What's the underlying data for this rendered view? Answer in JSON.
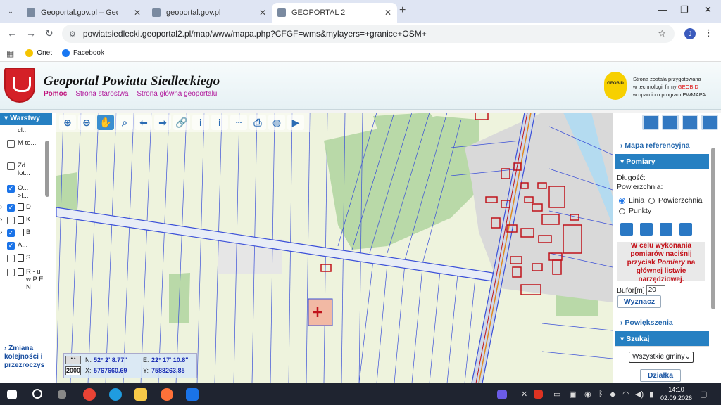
{
  "browser": {
    "tabs": [
      {
        "title": "Geoportal.gov.pl – Geoportal Infr",
        "active": false
      },
      {
        "title": "geoportal.gov.pl",
        "active": false
      },
      {
        "title": "GEOPORTAL 2",
        "active": true
      }
    ],
    "url": "powiatsiedlecki.geoportal2.pl/map/www/mapa.php?CFGF=wms&mylayers=+granice+OSM+",
    "profile_initial": "J",
    "bookmarks": [
      {
        "label": "Onet",
        "color": "#f5c400"
      },
      {
        "label": "Facebook",
        "color": "#1877f2"
      }
    ]
  },
  "site": {
    "title": "Geoportal Powiatu Siedleckiego",
    "nav": [
      "Pomoc",
      "Strona starostwa",
      "Strona główna geoportalu"
    ],
    "badge": "GEOBID",
    "credit_lines": [
      "Strona została przygotowana",
      "w technologii firmy ",
      "GEOBID",
      "w oparciu o program EWMAPA"
    ]
  },
  "layers_panel": {
    "header": "Warstwy",
    "items": [
      {
        "text": "cl...",
        "checked": null,
        "expander": false,
        "doc": false
      },
      {
        "text": "M to...",
        "checked": false,
        "expander": false,
        "doc": false
      },
      {
        "text": "Zd lot...",
        "checked": false,
        "expander": false,
        "doc": false
      },
      {
        "text": "O... >l...",
        "checked": true,
        "expander": false,
        "doc": false
      },
      {
        "text": "D",
        "checked": true,
        "expander": true,
        "doc": true
      },
      {
        "text": "K",
        "checked": false,
        "expander": true,
        "doc": true
      },
      {
        "text": "B",
        "checked": true,
        "expander": true,
        "doc": true
      },
      {
        "text": "A...",
        "checked": true,
        "expander": false,
        "doc": false
      },
      {
        "text": "S",
        "checked": false,
        "expander": false,
        "doc": true
      },
      {
        "text": "R - u w P E N",
        "checked": false,
        "expander": false,
        "doc": true
      }
    ],
    "footer_link": "Zmiana kolejności i przezroczys"
  },
  "coordinates": {
    "scale": "2000",
    "N_label": "N:",
    "N_value": "52° 2' 8.77\"",
    "E_label": "E:",
    "E_value": "22° 17' 10.8\"",
    "X_label": "X:",
    "X_value": "5767660.69",
    "Y_label": "Y:",
    "Y_value": "7588263.85"
  },
  "right_panel": {
    "sections": {
      "reference_map": "Mapa referencyjna",
      "measurements": "Pomiary",
      "zoom": "Powiększenia",
      "search": "Szukaj"
    },
    "length_label": "Długość:",
    "area_label": "Powierzchnia:",
    "radio_line": "Linia",
    "radio_area": "Powierzchnia",
    "radio_points": "Punkty",
    "hint_part1": "W celu wykonania pomiarów naciśnij przycisk ",
    "hint_em": "Pomiary",
    "hint_part2": " na głównej listwie narzędziowej.",
    "buffer_label": "Bufor[m]",
    "buffer_value": "20",
    "compute_button": "Wyznacz",
    "municipality_select": "Wszystkie gminy",
    "parcel_button": "Działka"
  },
  "taskbar": {
    "time": "14:10",
    "date": "02.09.2026"
  },
  "colors": {
    "accent": "#2680c2",
    "building": "#c0121a",
    "forest": "#b9d9a8",
    "meadow": "#eef3dd",
    "road": "#d0d8e8"
  }
}
